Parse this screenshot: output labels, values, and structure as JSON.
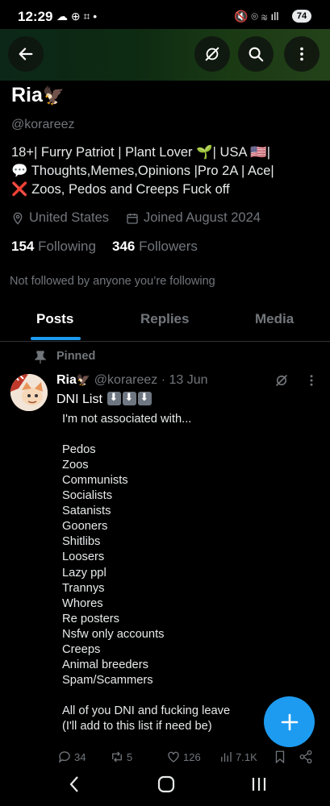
{
  "status_bar": {
    "time": "12:29",
    "battery": "74"
  },
  "profile": {
    "name": "Ria",
    "handle": "@korareez",
    "bio_lines": [
      "18+| Furry Patriot | Plant Lover 🌱| USA 🇺🇸|",
      "💬 Thoughts,Memes,Opinions |Pro 2A | Ace|",
      "❌ Zoos, Pedos and Creeps Fuck off"
    ],
    "location": "United States",
    "joined": "Joined August 2024",
    "following_count": "154",
    "following_label": "Following",
    "followers_count": "346",
    "followers_label": "Followers",
    "not_followed": "Not followed by anyone you’re following"
  },
  "tabs": [
    "Posts",
    "Replies",
    "Media"
  ],
  "post": {
    "pinned_label": "Pinned",
    "author_name": "Ria",
    "author_handle": "@korareez",
    "date": "· 13 Jun",
    "title": "DNI List",
    "lines": [
      "I'm not associated with...",
      "",
      "Pedos",
      "Zoos",
      "Communists",
      "Socialists",
      "Satanists",
      "Gooners",
      "Shitlibs",
      "Loosers",
      "Lazy ppl",
      "Trannys",
      "Whores",
      "Re posters",
      "Nsfw only accounts",
      "Creeps",
      "Animal breeders",
      "Spam/Scammers",
      "",
      "All of you DNI and fucking leave",
      "(I'll add to this list if need be)"
    ],
    "replies": "34",
    "reposts": "5",
    "likes": "126",
    "views": "7.1K"
  },
  "colors": {
    "accent": "#1d9bf0",
    "muted": "#71767b",
    "text": "#e7e9ea",
    "background": "#000000"
  }
}
